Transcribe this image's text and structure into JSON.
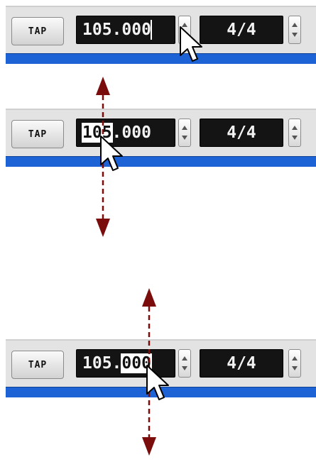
{
  "colors": {
    "accent_bar": "#1e63d6",
    "arrow": "#7a0c0c",
    "lcd_bg": "#141414"
  },
  "panels": [
    {
      "tap_label": "TAP",
      "tempo_pre": "105.000",
      "tempo_sel": "",
      "tempo_post": "",
      "time_signature": "4/4",
      "step": "tempo-stepper"
    },
    {
      "tap_label": "TAP",
      "tempo_pre": "",
      "tempo_sel": "105",
      "tempo_post": ".000",
      "time_signature": "4/4",
      "step": "integer-digits"
    },
    {
      "tap_label": "TAP",
      "tempo_pre": "105.",
      "tempo_sel": "000",
      "tempo_post": "",
      "time_signature": "4/4",
      "step": "decimal-digits"
    }
  ],
  "icons": {
    "cursor": "mouse-pointer-icon",
    "drag": "vertical-drag-arrow-icon"
  }
}
